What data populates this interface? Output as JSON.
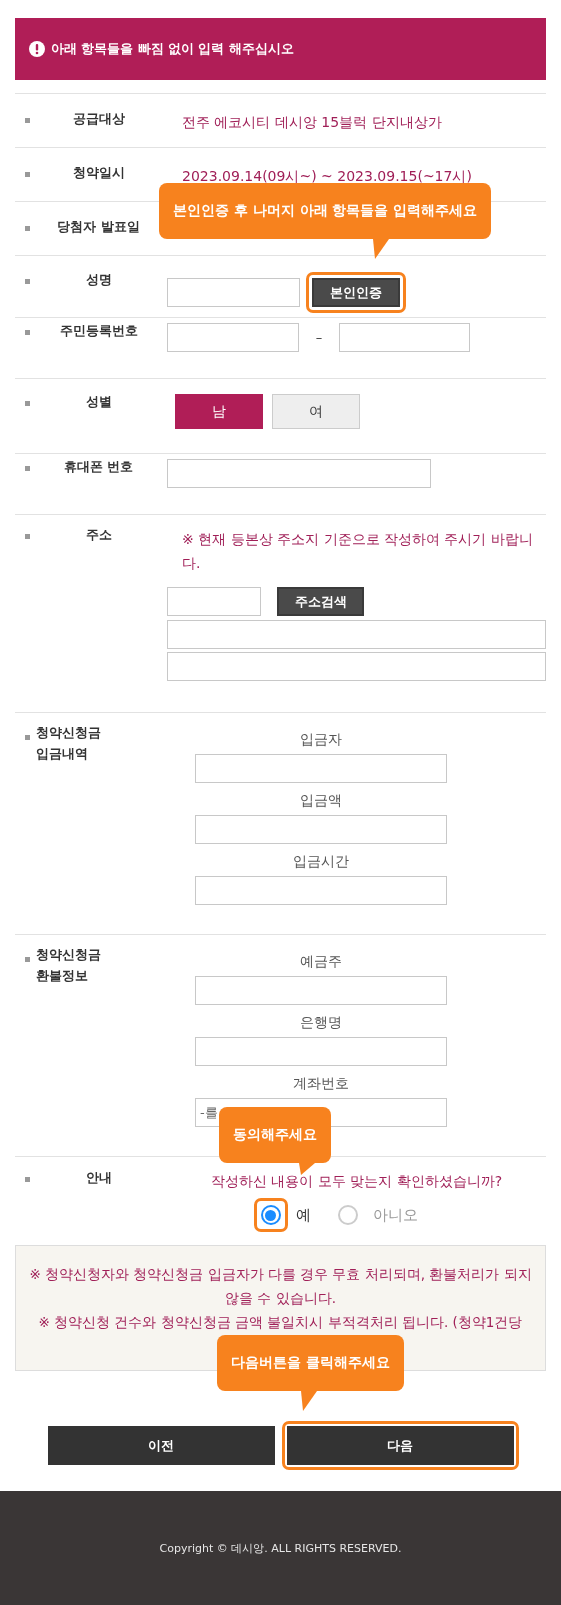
{
  "alert": "아래 항목들을 빠짐 없이 입력 해주십시오",
  "rows": [
    {
      "kind": "text",
      "label": "공급대상",
      "value": "전주 에코시티 데시앙 15블럭 단지내상가"
    },
    {
      "kind": "text",
      "label": "청약일시",
      "value": "2023.09.14(09시~) ~ 2023.09.15(~17시)"
    },
    {
      "kind": "text",
      "label": "당첨자 발표일"
    },
    {
      "kind": "name",
      "label": "성명",
      "button": "본인인증",
      "highlighted": true,
      "tooltip": "본인인증 후 나머지 아래 항목들을 입력해주세요"
    },
    {
      "kind": "ssn",
      "label": "주민등록번호",
      "separator": "–"
    },
    {
      "kind": "gender",
      "label": "성별",
      "options": [
        {
          "label": "남",
          "selected": true
        },
        {
          "label": "여",
          "selected": false
        }
      ]
    },
    {
      "kind": "phone",
      "label": "휴대폰 번호"
    },
    {
      "kind": "address",
      "label": "주소",
      "note": "※ 현재 등본상 주소지 기준으로 작성하여 주시기 바랍니다.",
      "button": "주소검색"
    },
    {
      "kind": "stack",
      "label": "청약신청금 입금내역",
      "fields": [
        {
          "label": "입금자"
        },
        {
          "label": "입금액"
        },
        {
          "label": "입금시간"
        }
      ]
    },
    {
      "kind": "stack",
      "label": "청약신청금 환불정보",
      "fields": [
        {
          "label": "예금주"
        },
        {
          "label": "은행명"
        },
        {
          "label": "계좌번호",
          "placeholder": "-를"
        }
      ]
    },
    {
      "kind": "confirm",
      "label": "안내",
      "question": "작성하신 내용이 모두 맞는지 확인하셨습니까?",
      "tooltip": "동의해주세요",
      "options": [
        {
          "label": "예",
          "selected": true,
          "highlighted": true
        },
        {
          "label": "아니오",
          "selected": false,
          "highlighted": false
        }
      ]
    }
  ],
  "notice": [
    "※ 청약신청자와 청약신청금 입금자가 다를 경우 무효 처리되며, 환불처리가 되지 않을 수 있습니다.",
    "※ 청약신청 건수와 청약신청금 금액 불일치시 부적격처리 됩니다. (청약1건당"
  ],
  "buttons": [
    {
      "label": "이전",
      "highlighted": false
    },
    {
      "label": "다음",
      "highlighted": true,
      "tooltip": "다음버튼을 클릭해주세요"
    }
  ],
  "footer": "Copyright © 데시앙. ALL RIGHTS RESERVED."
}
